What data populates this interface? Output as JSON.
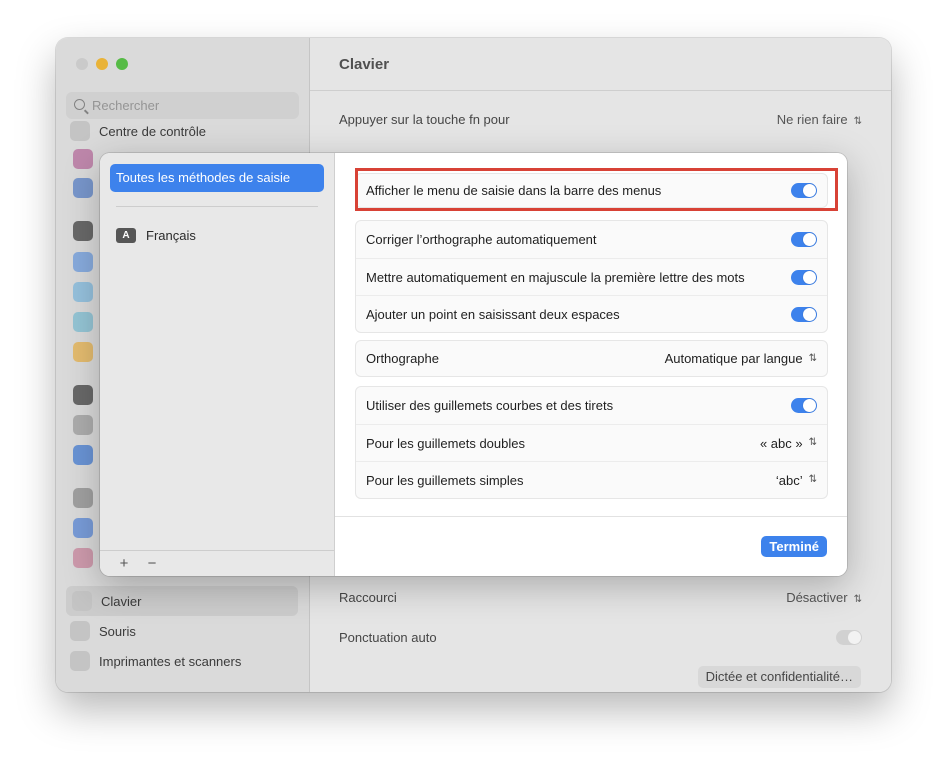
{
  "window": {
    "title": "Clavier",
    "search_placeholder": "Rechercher",
    "sidebar": {
      "top_item": "Centre de contrôle",
      "items": [
        "Clavier",
        "Souris",
        "Imprimantes et scanners"
      ],
      "selected": "Clavier"
    },
    "rows": {
      "fn_label": "Appuyer sur la touche fn pour",
      "fn_value": "Ne rien faire",
      "raccourci_label": "Raccourci",
      "raccourci_value": "Désactiver",
      "ponctuation_label": "Ponctuation auto",
      "dictee_button": "Dictée et confidentialité…"
    }
  },
  "sheet": {
    "sources_title": "Toutes les méthodes de saisie",
    "language": {
      "badge": "A",
      "name": "Français"
    },
    "add_label": "+",
    "remove_label": "−",
    "highlighted_row": {
      "label": "Afficher le menu de saisie dans la barre des menus",
      "on": true
    },
    "group1": [
      {
        "label": "Corriger l’orthographe automatiquement",
        "on": true
      },
      {
        "label": "Mettre automatiquement en majuscule la première lettre des mots",
        "on": true
      },
      {
        "label": "Ajouter un point en saisissant deux espaces",
        "on": true
      }
    ],
    "orthographe": {
      "label": "Orthographe",
      "value": "Automatique par langue"
    },
    "group3": {
      "toggle_row": {
        "label": "Utiliser des guillemets courbes et des tirets",
        "on": true
      },
      "double": {
        "label": "Pour les guillemets doubles",
        "value": "« abc »"
      },
      "simple": {
        "label": "Pour les guillemets simples",
        "value": "‘abc’"
      }
    },
    "done_button": "Terminé"
  },
  "colors": {
    "accent": "#3d82ec",
    "highlight": "#d84236"
  }
}
